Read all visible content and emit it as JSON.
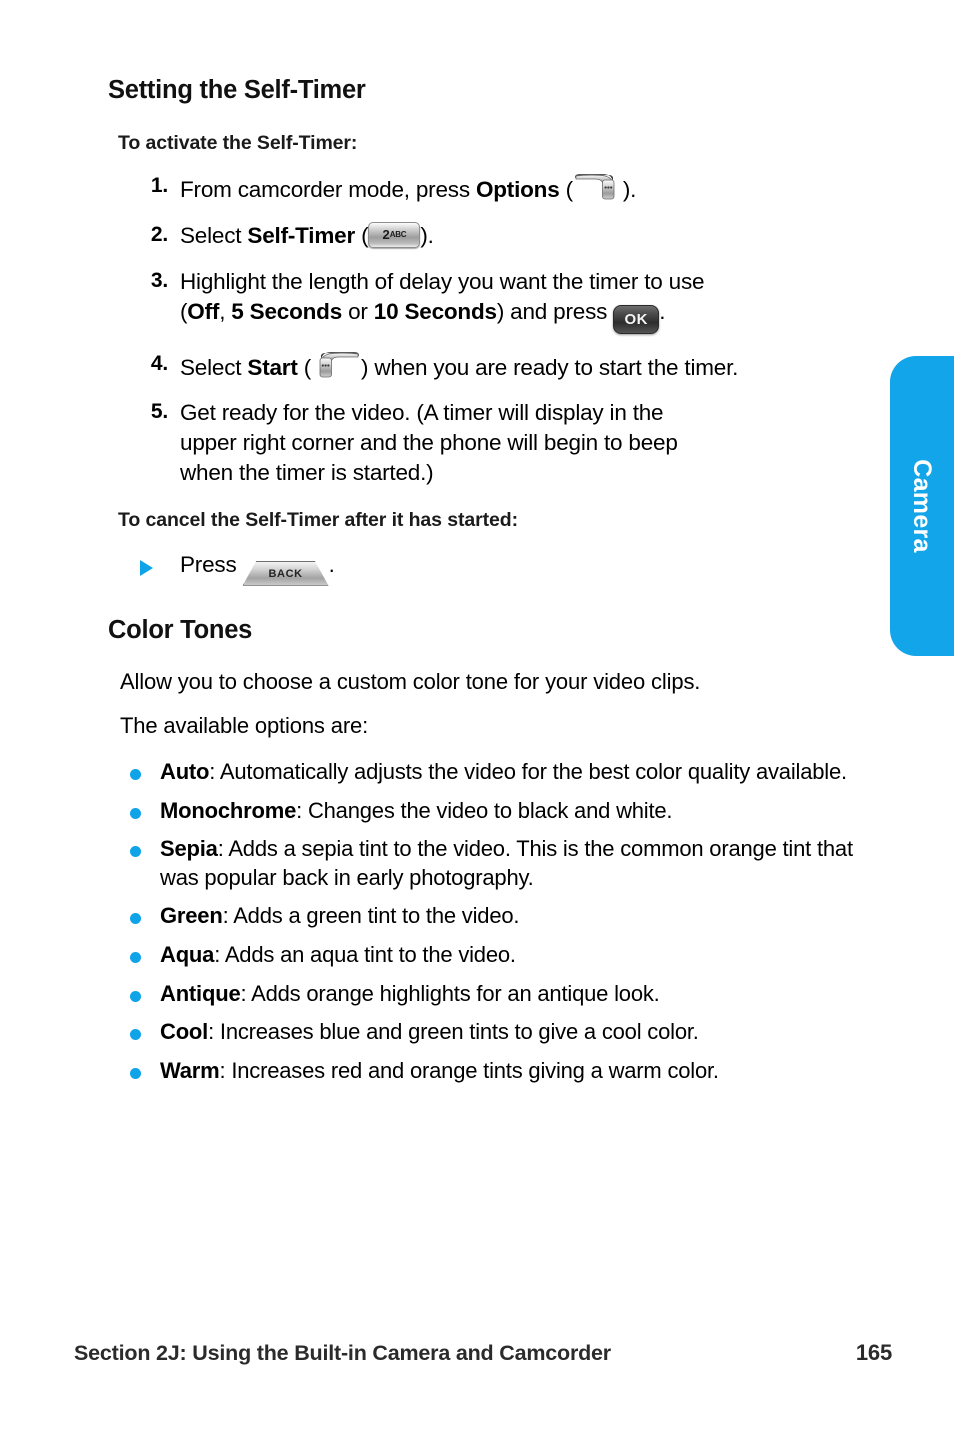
{
  "page": {
    "number": "165",
    "footer_section": "Section 2J: Using the Built-in Camera and Camcorder",
    "side_tab_label": "Camera",
    "accent_color": "#12A5E9"
  },
  "sections": [
    {
      "heading": "Setting the Self-Timer",
      "subhead_activate": "To activate the Self-Timer:",
      "subhead_cancel": "To cancel the Self-Timer after it has started:"
    },
    {
      "heading": "Color Tones",
      "intro": "Allow you to choose a custom color tone for your video clips.",
      "options_lead": "The available options are:"
    }
  ],
  "steps": [
    {
      "num": "1.",
      "text_before": "From camcorder mode, press ",
      "bold": "Options",
      "text_mid": " (",
      "icon": "right-softkey-icon",
      "text_after": ")."
    },
    {
      "num": "2.",
      "text_before": "Select ",
      "bold": "Self-Timer",
      "text_mid": " (",
      "icon": "key-2abc-icon",
      "key_label": "2",
      "key_sublabel": "ABC",
      "text_after": ")."
    },
    {
      "num": "3.",
      "line1": "Highlight the length of delay you want the timer to use",
      "line2_open": "(",
      "opt1": "Off",
      "sep1": ", ",
      "opt2": "5 Seconds",
      "sep2": " or ",
      "opt3": "10 Seconds",
      "line2_mid": ") and press ",
      "icon": "ok-key-icon",
      "key_label": "OK",
      "text_after": "."
    },
    {
      "num": "4.",
      "text_before": "Select ",
      "bold": "Start",
      "text_mid": " (",
      "icon": "left-softkey-icon",
      "text_after": ") when you are ready to start the timer."
    },
    {
      "num": "5.",
      "line1": "Get ready for the video. (A timer will display in the",
      "line2": "upper right corner and the phone will begin to beep",
      "line3": "when the timer is started.)"
    }
  ],
  "cancel_step": {
    "bullet": "arrow-bullet-icon",
    "text_before": "Press ",
    "icon": "back-key-icon",
    "key_label": "BACK",
    "text_after": "."
  },
  "color_tones": [
    {
      "name": "Auto",
      "desc": ": Automatically adjusts the video for the best color quality available."
    },
    {
      "name": "Monochrome",
      "desc": ": Changes the video to black and white."
    },
    {
      "name": "Sepia",
      "desc": ": Adds a sepia tint to the video. This is the common orange tint that was popular back in early photography."
    },
    {
      "name": "Green",
      "desc": ": Adds a green tint to the video."
    },
    {
      "name": "Aqua",
      "desc": ": Adds an aqua tint to the video."
    },
    {
      "name": "Antique",
      "desc": ": Adds orange highlights for an antique look."
    },
    {
      "name": "Cool",
      "desc": ": Increases blue and green tints to give a cool color."
    },
    {
      "name": "Warm",
      "desc": ": Increases red and orange tints giving a warm color."
    }
  ]
}
